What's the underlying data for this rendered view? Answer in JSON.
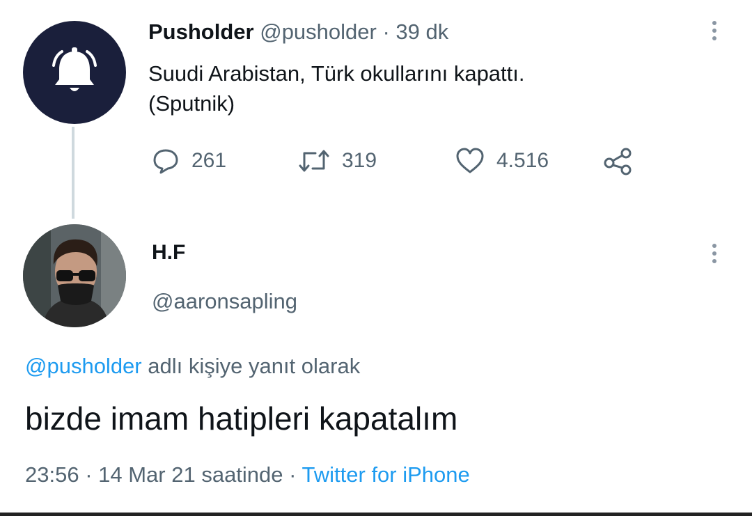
{
  "parent_tweet": {
    "display_name": "Pusholder",
    "handle": "@pusholder",
    "separator": " · ",
    "time_ago": "39 dk",
    "text_line1": "Suudi Arabistan, Türk okullarını kapattı.",
    "text_line2": "(Sputnik)",
    "avatar_icon": "bell-icon",
    "avatar_bg": "#1a1f3b",
    "replies": "261",
    "retweets": "319",
    "likes": "4.516"
  },
  "reply_tweet": {
    "display_name": "H.F",
    "handle": "@aaronsapling",
    "reply_to_mention": "@pusholder",
    "reply_to_suffix": " adlı kişiye yanıt olarak",
    "text": "bizde imam hatipleri kapatalım",
    "time": "23:56",
    "sep1": " · ",
    "date": "14 Mar 21 saatinde",
    "sep2": " · ",
    "source": "Twitter for iPhone"
  },
  "colors": {
    "link": "#1d9bf0",
    "secondary_text": "#536471",
    "thread_line": "#cfd9de"
  }
}
